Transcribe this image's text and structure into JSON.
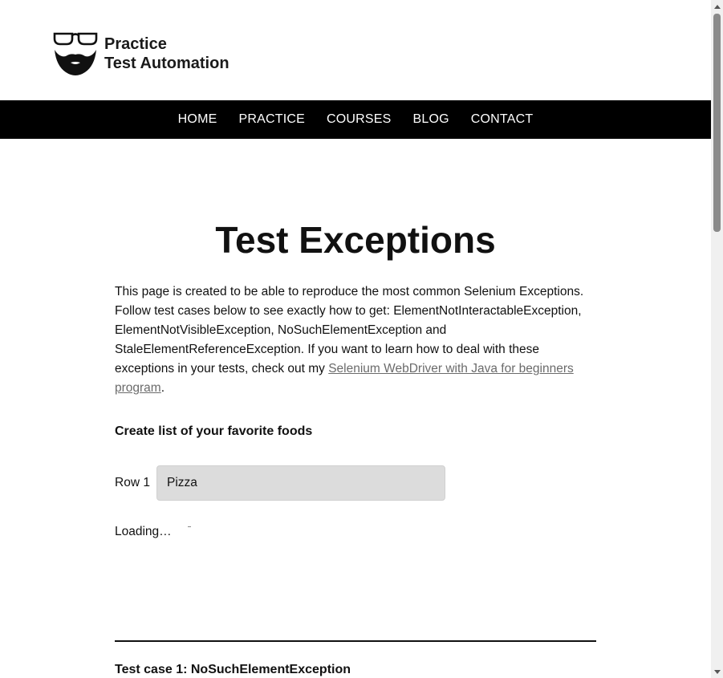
{
  "site": {
    "logo_line1": "Practice",
    "logo_line2": "Test Automation",
    "logo_icon": "bearded-face-glasses-icon"
  },
  "nav": {
    "items": [
      "HOME",
      "PRACTICE",
      "COURSES",
      "BLOG",
      "CONTACT"
    ]
  },
  "page": {
    "title": "Test Exceptions",
    "intro_text": "This page is created to be able to reproduce the most common Selenium Exceptions. Follow test cases below to see exactly how to get: ElementNotInteractableException, ElementNotVisibleException, NoSuchElementException and StaleElementReferenceException. If you want to learn how to deal with these exceptions in your tests, check out my ",
    "intro_link": "Selenium WebDriver with Java for beginners program",
    "intro_end": ".",
    "section_title": "Create list of your favorite foods",
    "row1_label": "Row 1",
    "row1_value": "Pizza",
    "loading_text": "Loading…",
    "testcase1_title": "Test case 1: NoSuchElementException"
  },
  "colors": {
    "nav_bg": "#000000",
    "nav_text": "#ffffff",
    "input_bg": "#dcdcdc",
    "link": "#6b6b6b"
  }
}
